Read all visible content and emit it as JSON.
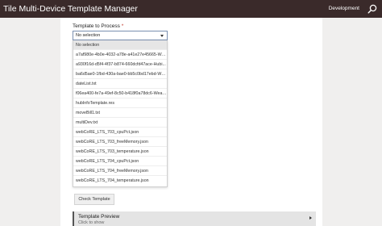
{
  "header": {
    "title": "Tile Multi-Device Template Manager",
    "environment": "Development"
  },
  "form": {
    "label": "Template to Process",
    "required_marker": "*",
    "selected_value": "No selection",
    "options": [
      "No selection",
      "a7af980e-4b0e-4032-a78e-a41e27e45665-Wea...",
      "a930f16d-d5f4-4f37-b874-660dcfd47ace-Hubi...",
      "ba6d5ae0-1fbd-430a-bae0-bb5c0bd17ebd-Wea...",
      "dateList.txt",
      "f06ea400-fe7a-49ef-8c50-b418f0a78dc6-Weat...",
      "hubInfoTemplate.res",
      "moveBill1.txt",
      "multiDev.txt",
      "webCoRE_LTS_703_cpuPct.json",
      "webCoRE_LTS_703_freeMemory.json",
      "webCoRE_LTS_703_temperature.json",
      "webCoRE_LTS_704_cpuPct.json",
      "webCoRE_LTS_704_freeMemory.json",
      "webCoRE_LTS_704_temperature.json"
    ],
    "check_button": "Check Template"
  },
  "preview": {
    "title": "Template Preview",
    "subtitle": "Click to show"
  }
}
